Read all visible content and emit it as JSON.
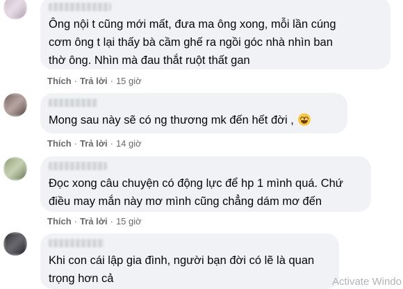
{
  "actions": {
    "like": "Thích",
    "reply": "Trả lời",
    "separator": "·"
  },
  "comments": [
    {
      "text_lines": [
        "Ông nội t cũng mới mất, đưa ma ông xong, mỗi lần cúng",
        "cơm ông t lại thấy bà cầm ghế ra ngồi góc nhà nhìn ban",
        "thờ ông. Nhìn mà đau thắt ruột thất gan"
      ],
      "time": "15 giờ"
    },
    {
      "text_lines": [
        "Mong sau này sẽ có ng thương mk đến hết đời ,"
      ],
      "emoji": "grinning-face-emoji",
      "time": "14 giờ"
    },
    {
      "text_lines": [
        "Đọc xong câu chuyện có động lực để hp 1 mình quá. Chứ",
        "điều may mắn này mơ mình cũng chẳng dám mơ đến"
      ],
      "time": "15 giờ"
    },
    {
      "text_lines": [
        "Khi con cái lập gia đình, người bạn đời có lẽ là quan",
        "trọng hơn cả"
      ]
    }
  ],
  "watermark": "Activate Windo",
  "colors": {
    "bubble": "#f0f2f5",
    "meta_text": "#65676b",
    "text": "#050505"
  }
}
